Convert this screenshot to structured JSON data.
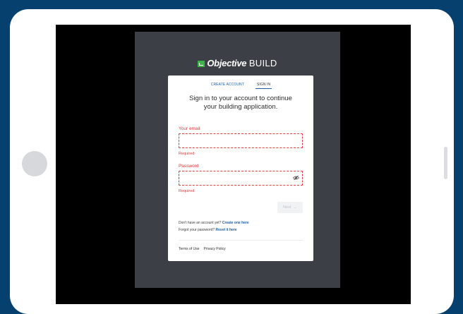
{
  "brand": {
    "name_bold": "Objective",
    "name_light": "BUILD",
    "logo_color": "#3bb54a"
  },
  "tabs": [
    {
      "label": "CREATE ACCOUNT",
      "active": false
    },
    {
      "label": "SIGN IN",
      "active": true
    }
  ],
  "heading": "Sign in to your account to continue your building application.",
  "email": {
    "label": "Your email",
    "value": "",
    "placeholder": "",
    "error": "Required"
  },
  "password": {
    "label": "Password",
    "value": "",
    "placeholder": "",
    "error": "Required",
    "toggle_icon": "eye-slash-icon"
  },
  "next_button": {
    "label": "Next",
    "icon": "arrow-right-icon"
  },
  "signup_prompt": {
    "text": "Don't have an account yet?",
    "link": "Create one here"
  },
  "reset_prompt": {
    "text": "Forgot your password?",
    "link": "Reset it here"
  },
  "footer": {
    "terms": "Terms of Use",
    "privacy": "Privacy Policy"
  },
  "colors": {
    "error": "#e23b3b",
    "link": "#1f61a8",
    "background": "#05406e",
    "panel": "#3c3f45"
  }
}
